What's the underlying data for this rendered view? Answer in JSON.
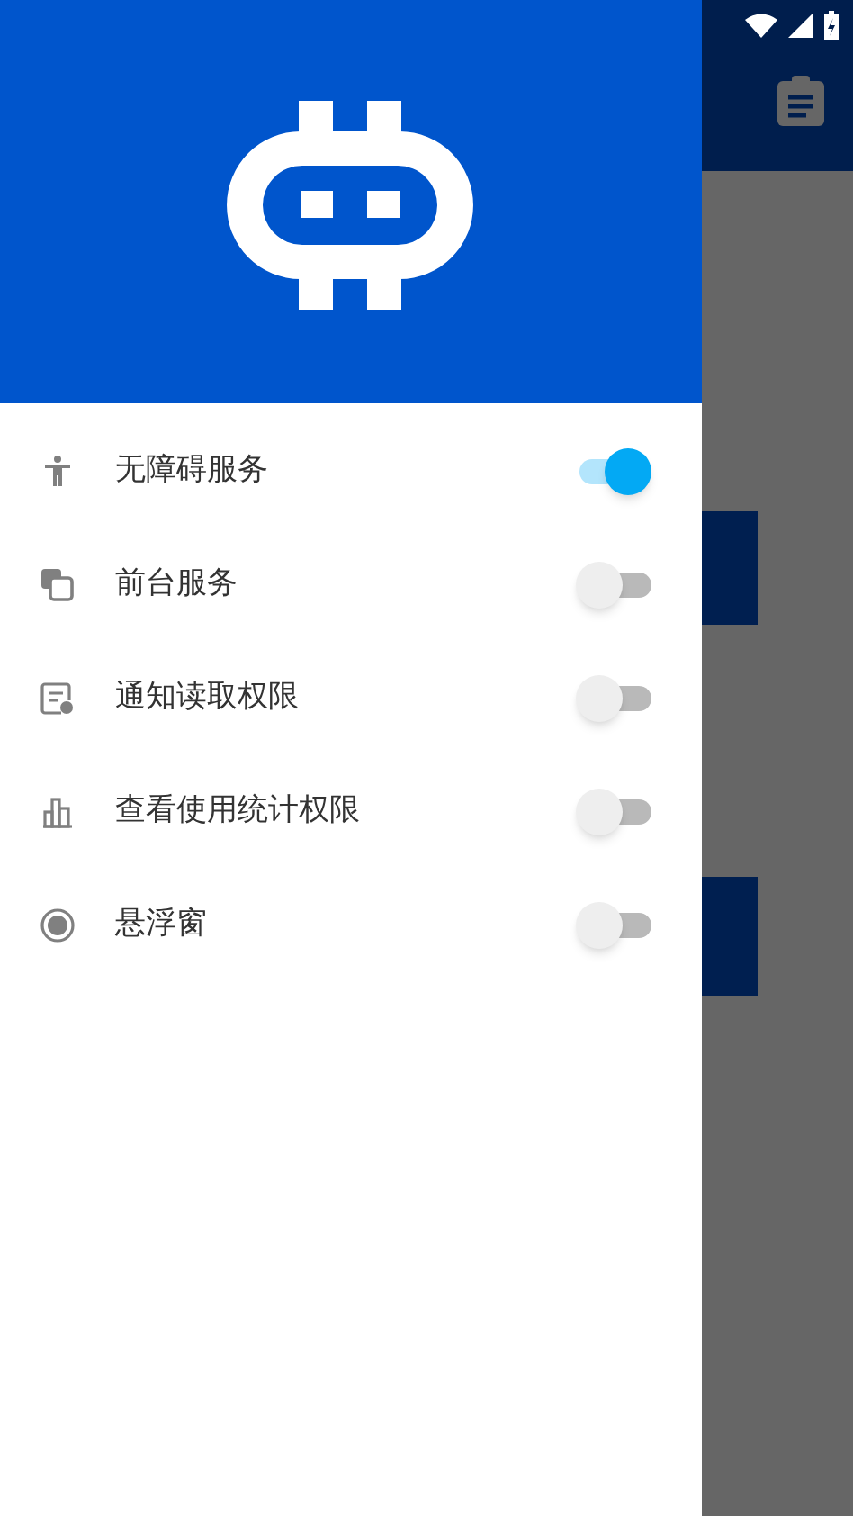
{
  "drawer": {
    "items": [
      {
        "label": "无障碍服务",
        "on": true
      },
      {
        "label": "前台服务",
        "on": false
      },
      {
        "label": "通知读取权限",
        "on": false
      },
      {
        "label": "查看使用统计权限",
        "on": false
      },
      {
        "label": "悬浮窗",
        "on": false
      }
    ]
  }
}
